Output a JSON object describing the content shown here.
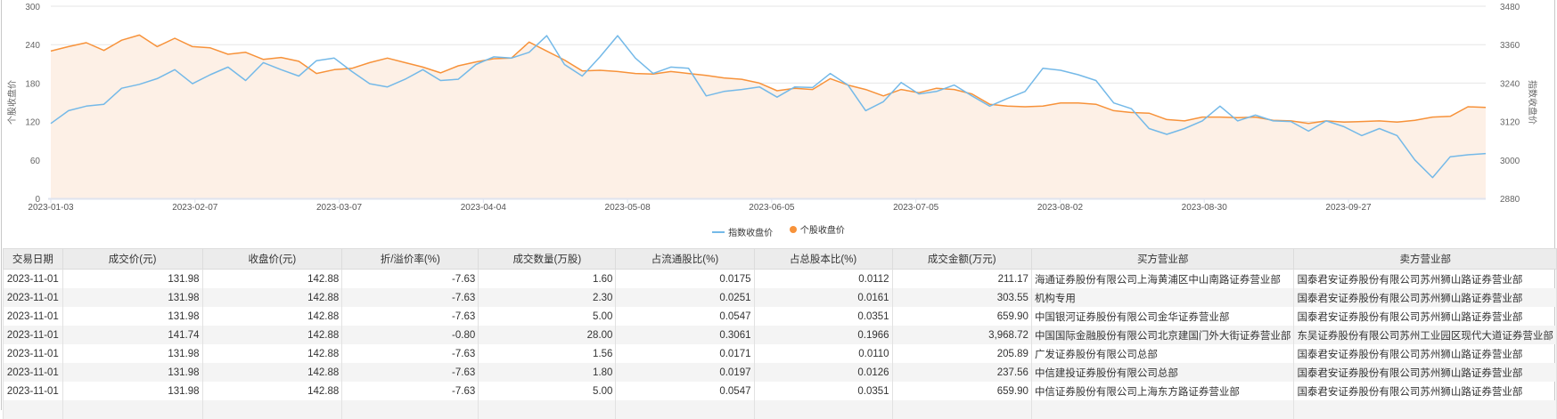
{
  "chart_data": {
    "type": "line",
    "title": "",
    "x_ticks": [
      "2023-01-03",
      "2023-02-07",
      "2023-03-07",
      "2023-04-04",
      "2023-05-08",
      "2023-06-05",
      "2023-07-05",
      "2023-08-02",
      "2023-08-30",
      "2023-09-27"
    ],
    "x_range": [
      "2023-01-03",
      "2023-10-31"
    ],
    "y_left": {
      "label": "个股收盘价",
      "ticks": [
        0,
        60,
        120,
        180,
        240,
        300
      ],
      "range": [
        0,
        300
      ]
    },
    "y_right": {
      "label": "指数收盘价",
      "ticks": [
        2880,
        3000,
        3120,
        3240,
        3360,
        3480
      ],
      "range": [
        2880,
        3480
      ]
    },
    "grid": true,
    "legend_position": "bottom",
    "series": [
      {
        "name": "指数收盘价",
        "axis": "right",
        "color": "#74b9e8",
        "style": "line",
        "values": [
          3114,
          3154,
          3168,
          3174,
          3224,
          3236,
          3254,
          3282,
          3238,
          3266,
          3290,
          3248,
          3304,
          3282,
          3262,
          3310,
          3318,
          3276,
          3238,
          3228,
          3252,
          3282,
          3248,
          3252,
          3298,
          3322,
          3318,
          3336,
          3388,
          3298,
          3262,
          3322,
          3388,
          3318,
          3270,
          3290,
          3286,
          3200,
          3214,
          3220,
          3228,
          3196,
          3228,
          3226,
          3270,
          3234,
          3154,
          3182,
          3242,
          3206,
          3214,
          3234,
          3200,
          3168,
          3192,
          3214,
          3286,
          3280,
          3266,
          3248,
          3178,
          3160,
          3098,
          3080,
          3098,
          3122,
          3168,
          3122,
          3140,
          3122,
          3120,
          3090,
          3122,
          3104,
          3076,
          3098,
          3076,
          3000,
          2945,
          3010,
          3016,
          3020
        ]
      },
      {
        "name": "个股收盘价",
        "axis": "left",
        "color": "#f7923a",
        "style": "area",
        "values": [
          230,
          237,
          243,
          231,
          247,
          255,
          237,
          250,
          237,
          235,
          225,
          228,
          217,
          220,
          214,
          195,
          201,
          203,
          212,
          219,
          212,
          205,
          196,
          207,
          213,
          218,
          219,
          244,
          230,
          216,
          199,
          200,
          198,
          195,
          194,
          198,
          195,
          192,
          188,
          186,
          180,
          168,
          172,
          170,
          187,
          177,
          170,
          160,
          170,
          165,
          172,
          170,
          163,
          147,
          144,
          143,
          144,
          149,
          149,
          147,
          137,
          134,
          133,
          123,
          121,
          127,
          127,
          126,
          127,
          122,
          121,
          117,
          121,
          119,
          120,
          121,
          119,
          122,
          127,
          128,
          143,
          142
        ]
      }
    ]
  },
  "colors": {
    "index": "#74b9e8",
    "stock": "#f7923a",
    "area": "#fdf0e6"
  },
  "table": {
    "headers": [
      "交易日期",
      "成交价(元)",
      "收盘价(元)",
      "折/溢价率(%)",
      "成交数量(万股)",
      "占流通股比(%)",
      "占总股本比(%)",
      "成交金额(万元)",
      "买方营业部",
      "卖方营业部"
    ],
    "rows": [
      [
        "2023-11-01",
        "131.98",
        "142.88",
        "-7.63",
        "1.60",
        "0.0175",
        "0.0112",
        "211.17",
        "海通证券股份有限公司上海黄浦区中山南路证券营业部",
        "国泰君安证券股份有限公司苏州狮山路证券营业部"
      ],
      [
        "2023-11-01",
        "131.98",
        "142.88",
        "-7.63",
        "2.30",
        "0.0251",
        "0.0161",
        "303.55",
        "机构专用",
        "国泰君安证券股份有限公司苏州狮山路证券营业部"
      ],
      [
        "2023-11-01",
        "131.98",
        "142.88",
        "-7.63",
        "5.00",
        "0.0547",
        "0.0351",
        "659.90",
        "中国银河证券股份有限公司金华证券营业部",
        "国泰君安证券股份有限公司苏州狮山路证券营业部"
      ],
      [
        "2023-11-01",
        "141.74",
        "142.88",
        "-0.80",
        "28.00",
        "0.3061",
        "0.1966",
        "3,968.72",
        "中国国际金融股份有限公司北京建国门外大街证券营业部",
        "东吴证券股份有限公司苏州工业园区现代大道证券营业部"
      ],
      [
        "2023-11-01",
        "131.98",
        "142.88",
        "-7.63",
        "1.56",
        "0.0171",
        "0.0110",
        "205.89",
        "广发证券股份有限公司总部",
        "国泰君安证券股份有限公司苏州狮山路证券营业部"
      ],
      [
        "2023-11-01",
        "131.98",
        "142.88",
        "-7.63",
        "1.80",
        "0.0197",
        "0.0126",
        "237.56",
        "中信建投证券股份有限公司总部",
        "国泰君安证券股份有限公司苏州狮山路证券营业部"
      ],
      [
        "2023-11-01",
        "131.98",
        "142.88",
        "-7.63",
        "5.00",
        "0.0547",
        "0.0351",
        "659.90",
        "中信证券股份有限公司上海东方路证券营业部",
        "国泰君安证券股份有限公司苏州狮山路证券营业部"
      ],
      [
        "",
        "",
        "",
        "",
        "",
        "",
        "",
        "",
        "",
        ""
      ]
    ]
  }
}
